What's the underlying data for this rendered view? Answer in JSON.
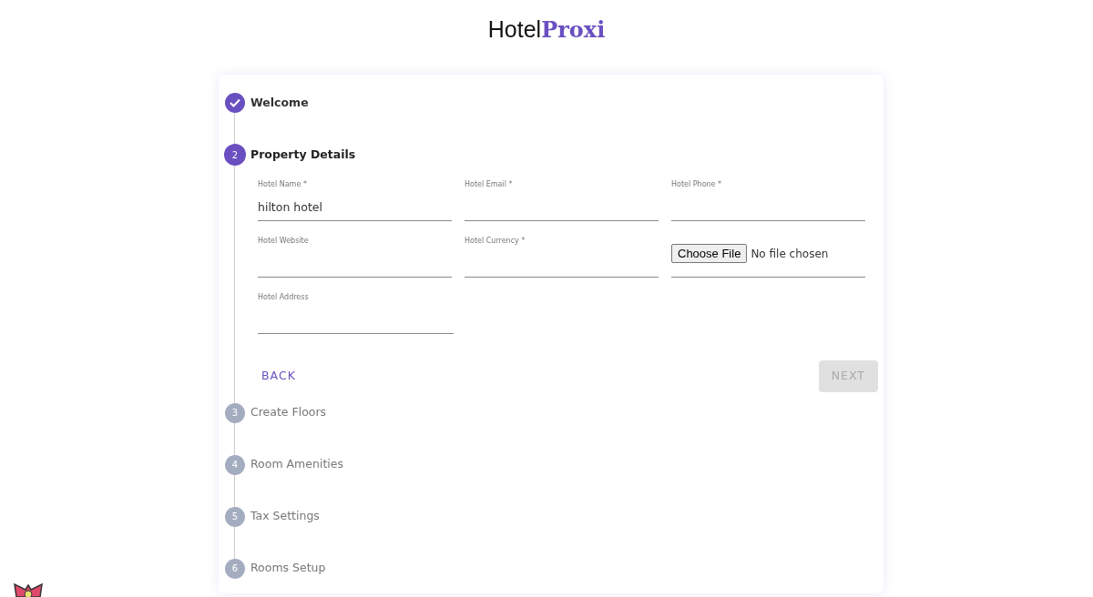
{
  "logo": {
    "part_1": "Hotel",
    "part_2": "Proxi"
  },
  "steps": [
    {
      "label": "Welcome",
      "done": true,
      "selected": false
    },
    {
      "number": "2",
      "label": "Property Details",
      "done": false,
      "selected": true
    },
    {
      "number": "3",
      "label": "Create Floors",
      "done": false,
      "selected": false
    },
    {
      "number": "4",
      "label": "Room Amenities",
      "done": false,
      "selected": false
    },
    {
      "number": "5",
      "label": "Tax Settings",
      "done": false,
      "selected": false
    },
    {
      "number": "6",
      "label": "Rooms Setup",
      "done": false,
      "selected": false
    }
  ],
  "fields": [
    {
      "kind": "text",
      "label": "Hotel Name *",
      "value": "hilton hotel"
    },
    {
      "kind": "text",
      "label": "Hotel Email *"
    },
    {
      "kind": "text",
      "label": "Hotel Phone *"
    },
    {
      "kind": "text",
      "label": "Hotel Website"
    },
    {
      "kind": "text",
      "label": "Hotel Currency *"
    },
    {
      "kind": "file",
      "button": "Choose File",
      "status": "No file chosen"
    },
    {
      "kind": "text",
      "label": "Hotel Address"
    }
  ],
  "buttons": {
    "back": {
      "label": "BACK",
      "disabled": false
    },
    "next": {
      "label": "NEXT",
      "disabled": true
    }
  }
}
